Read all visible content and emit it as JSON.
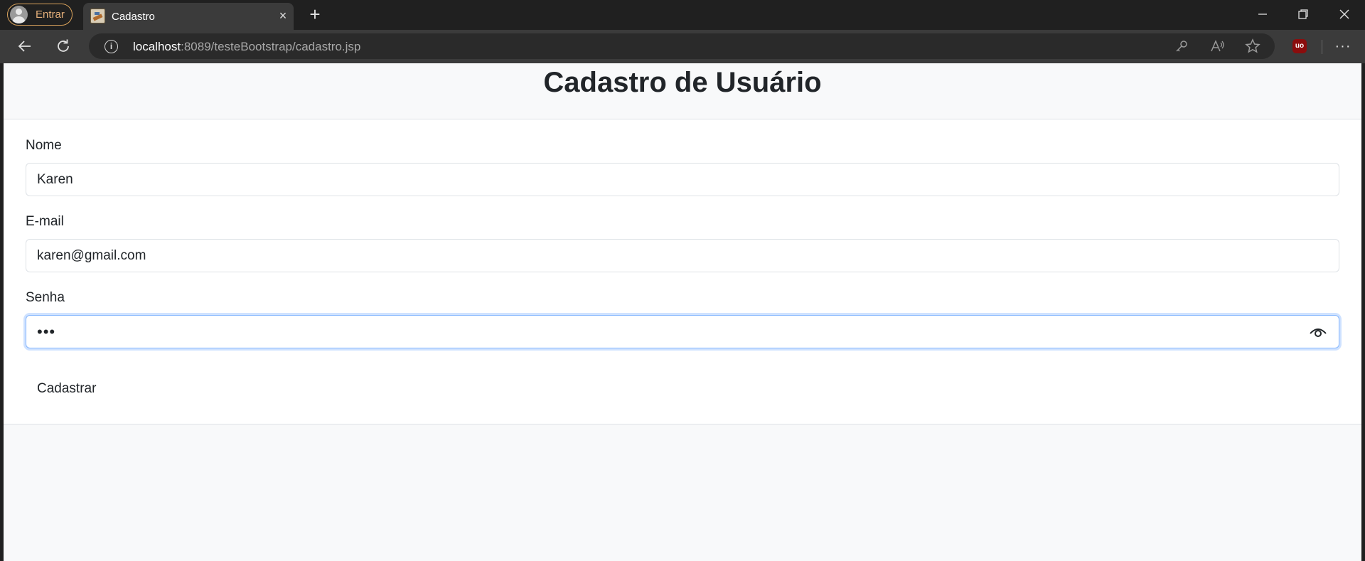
{
  "browser": {
    "profile_label": "Entrar",
    "tab_title": "Cadastro",
    "tab_close": "×",
    "new_tab": "+",
    "minimize": "—",
    "close": "✕",
    "url_host": "localhost",
    "url_rest": ":8089/testeBootstrap/cadastro.jsp",
    "more": "···",
    "ublock_label": "uo"
  },
  "page": {
    "title": "Cadastro de Usuário"
  },
  "form": {
    "name_label": "Nome",
    "name_value": "Karen",
    "email_label": "E-mail",
    "email_value": "karen@gmail.com",
    "password_label": "Senha",
    "password_mask": "•••",
    "submit_label": "Cadastrar"
  },
  "colors": {
    "profile_accent": "#e6b07a",
    "focus_border": "#86b7fe",
    "page_bg": "#f8f9fa",
    "text": "#212529"
  }
}
